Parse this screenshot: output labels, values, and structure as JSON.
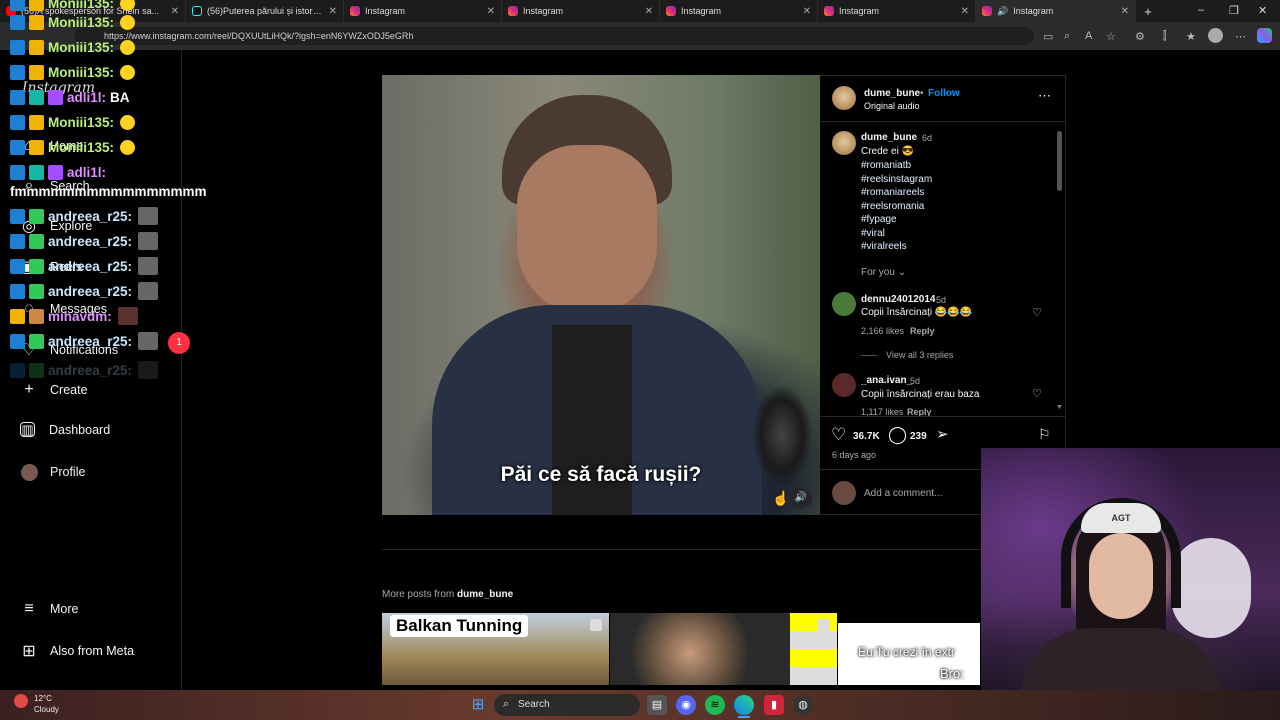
{
  "browser": {
    "tabs": [
      {
        "label": "(56)A spokesperson for Shein sa...",
        "icon": "youtube",
        "active": false
      },
      {
        "label": "(56)Puterea părului și istoria sa fa...",
        "icon": "tiktok",
        "active": false
      },
      {
        "label": "Instagram",
        "icon": "instagram",
        "active": false
      },
      {
        "label": "Instagram",
        "icon": "instagram",
        "active": false
      },
      {
        "label": "Instagram",
        "icon": "instagram",
        "active": false
      },
      {
        "label": "Instagram",
        "icon": "instagram",
        "active": false
      },
      {
        "label": "Instagram",
        "icon": "instagram",
        "active": true
      }
    ],
    "url": "https://www.instagram.com/reel/DQXUUtLiHQk/?igsh=enN6YWZxODJ5eGRh",
    "new_tab": "+",
    "window_controls": [
      "–",
      "❐",
      "✕"
    ]
  },
  "sidebar": {
    "logo": "Instagram",
    "items": [
      {
        "label": "Home",
        "icon": "home-icon"
      },
      {
        "label": "Search",
        "icon": "search-icon"
      },
      {
        "label": "Explore",
        "icon": "compass-icon"
      },
      {
        "label": "Reels",
        "icon": "reels-icon"
      },
      {
        "label": "Messages",
        "icon": "messenger-icon"
      },
      {
        "label": "Notifications",
        "icon": "heart-icon"
      },
      {
        "label": "Create",
        "icon": "plus-icon"
      },
      {
        "label": "Dashboard",
        "icon": "dashboard-icon"
      },
      {
        "label": "Profile",
        "icon": "avatar"
      },
      {
        "label": "More",
        "icon": "menu-icon"
      },
      {
        "label": "Also from Meta",
        "icon": "meta-icon"
      }
    ],
    "notifications_badge": "1"
  },
  "chat": [
    {
      "user": "Moniii135:",
      "msg": "",
      "color": "#b8f07a"
    },
    {
      "user": "Moniii135:",
      "msg": "",
      "color": "#b8f07a"
    },
    {
      "user": "Moniii135:",
      "msg": "",
      "color": "#b8f07a"
    },
    {
      "user": "Moniii135:",
      "msg": "",
      "color": "#b8f07a"
    },
    {
      "user": "adli1l:",
      "msg": "BA",
      "color": "#e08dff"
    },
    {
      "user": "Moniii135:",
      "msg": "",
      "color": "#b8f07a"
    },
    {
      "user": "Moniii135:",
      "msg": "",
      "color": "#b8f07a"
    },
    {
      "user": "adli1l:",
      "msg": "",
      "color": "#e08dff"
    },
    {
      "user": "",
      "msg": "fmmmmmmmmmmmmmmmm",
      "color": "#ffffff"
    },
    {
      "user": "andreea_r25:",
      "msg": "",
      "color": "#c9e8ff"
    },
    {
      "user": "andreea_r25:",
      "msg": "",
      "color": "#c9e8ff"
    },
    {
      "user": "andreea_r25:",
      "msg": "",
      "color": "#c9e8ff"
    },
    {
      "user": "andreea_r25:",
      "msg": "",
      "color": "#c9e8ff"
    },
    {
      "user": "mihavdm:",
      "msg": "",
      "color": "#e08dff"
    },
    {
      "user": "andreea_r25:",
      "msg": "",
      "color": "#c9e8ff"
    },
    {
      "user": "andreea_r25:",
      "msg": "",
      "color": "#c9e8ff"
    }
  ],
  "post": {
    "video_caption": "Păi ce să facă rușii?",
    "author": "dume_bune",
    "follow": "Follow",
    "separator": "•",
    "audio": "Original audio",
    "caption_time": "6d",
    "caption_text": "Crede ei 😎",
    "hashtags": [
      "#romaniatb",
      "#reelsinstagram",
      "#romaniareels",
      "#reelsromania",
      "#fypage",
      "#viral",
      "#viralreels"
    ],
    "for_you": "For you",
    "comments": [
      {
        "user": "dennu24012014",
        "time": "5d",
        "text": "Copii însărcinați 😂😂😂",
        "likes": "2,166 likes",
        "reply": "Reply"
      },
      {
        "user": "_ana.ivan_",
        "time": "5d",
        "text": "Copii însărcinați erau baza",
        "likes": "1,117 likes",
        "reply": "Reply"
      }
    ],
    "view_replies": "View all 3 replies",
    "like_count": "36.7K",
    "comment_count": "239",
    "posted": "6 days ago",
    "add_comment_placeholder": "Add a comment..."
  },
  "more_posts": {
    "label": "More posts from",
    "author": "dume_bune",
    "thumbs": [
      {
        "text": "Balkan Tunning"
      },
      {
        "text": ""
      },
      {
        "text": "Eu:Tu crezi în extr",
        "text2": "Bro:"
      }
    ]
  },
  "taskbar": {
    "weather_temp": "12°C",
    "weather_desc": "Cloudy",
    "search_label": "Search"
  },
  "webcam": {
    "beanie_text": "AGT"
  },
  "colors": {
    "accent_link": "#0095f6",
    "follow": "#0095f6",
    "badge": "#ff3040"
  }
}
